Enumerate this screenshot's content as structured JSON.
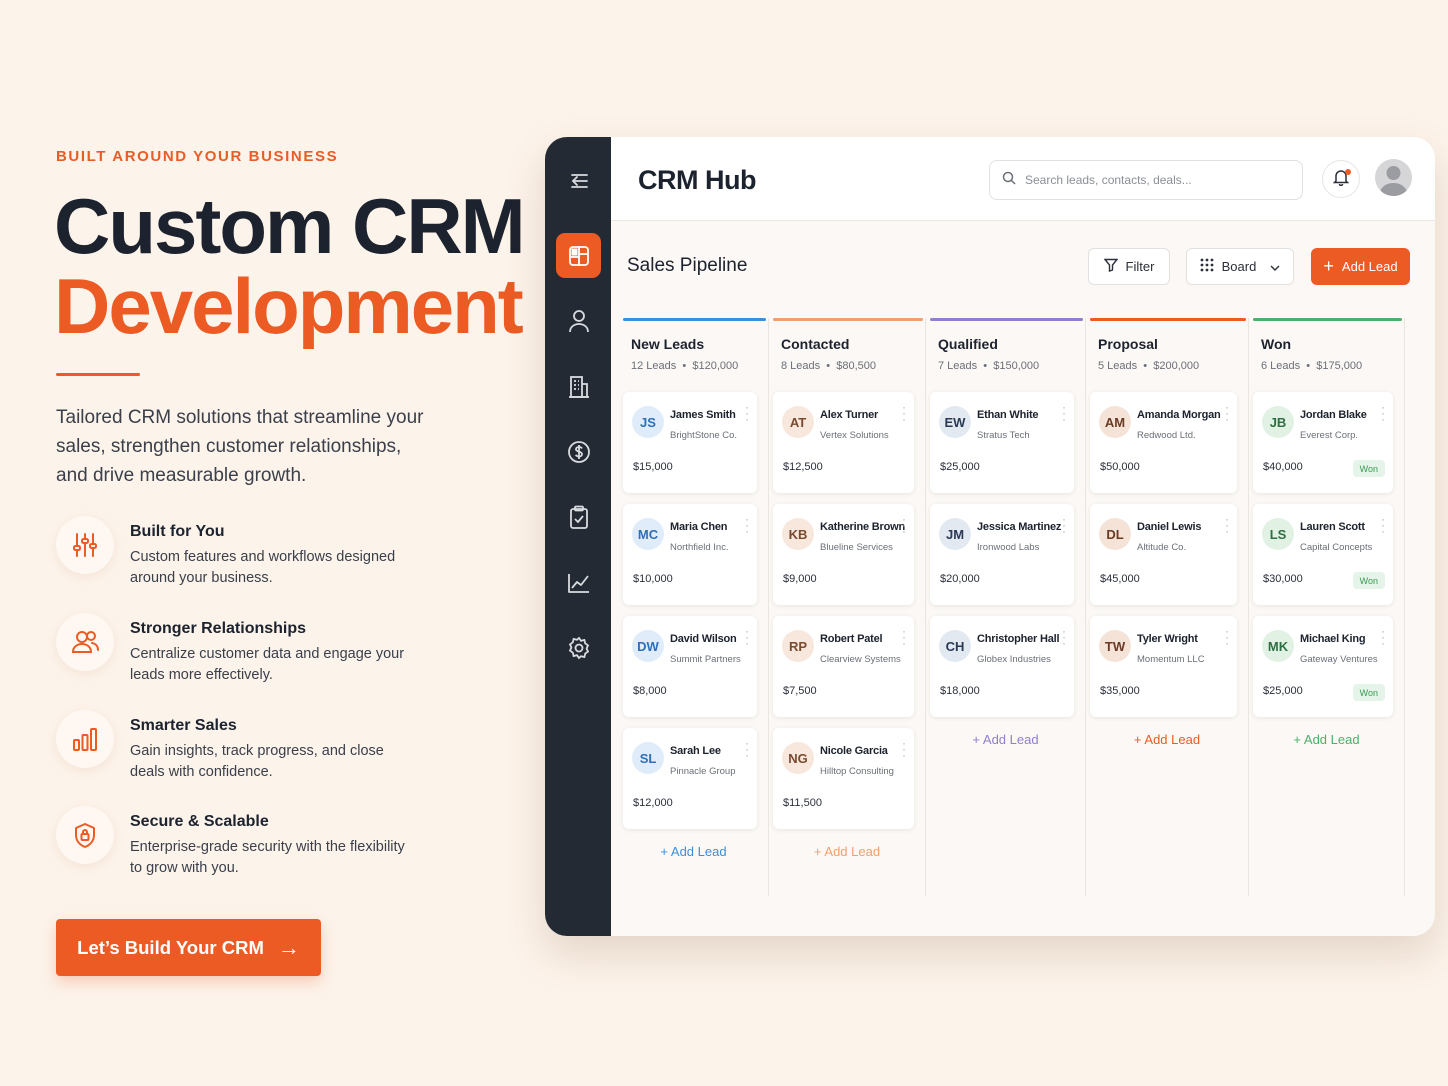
{
  "hero": {
    "eyebrow": "BUILT AROUND YOUR BUSINESS",
    "title_line1": "Custom CRM",
    "title_line2": "Development",
    "description": "Tailored CRM solutions that streamline your sales, strengthen customer relationships, and drive measurable growth.",
    "accent": "#ec5b24"
  },
  "features": [
    {
      "icon": "sliders-icon",
      "title": "Built for You",
      "desc": "Custom features and workflows designed around your business."
    },
    {
      "icon": "users-icon",
      "title": "Stronger Relationships",
      "desc": "Centralize customer data and engage your leads more effectively."
    },
    {
      "icon": "bar-chart-icon",
      "title": "Smarter Sales",
      "desc": "Gain insights, track progress, and close deals with confidence."
    },
    {
      "icon": "shield-lock-icon",
      "title": "Secure & Scalable",
      "desc": "Enterprise-grade security with the flexibility to grow with you."
    }
  ],
  "cta": {
    "label": "Let’s Build Your CRM",
    "arrow": "→"
  },
  "app": {
    "title": "CRM Hub",
    "search_placeholder": "Search leads, contacts, deals...",
    "sidebar": [
      "menu-icon",
      "dashboard-icon",
      "user-icon",
      "building-icon",
      "dollar-icon",
      "clipboard-check-icon",
      "chart-icon",
      "gear-icon"
    ],
    "page_title": "Sales Pipeline",
    "filter_label": "Filter",
    "board_label": "Board",
    "add_lead_label": "Add Lead",
    "columns": [
      {
        "name": "New Leads",
        "count": "12 Leads",
        "total": "$120,000",
        "color": "#3d8fd9",
        "add_label": "+ Add Lead",
        "cards": [
          {
            "initials": "JS",
            "name": "James Smith",
            "company": "BrightStone Co.",
            "amount": "$15,000"
          },
          {
            "initials": "MC",
            "name": "Maria Chen",
            "company": "Northfield Inc.",
            "amount": "$10,000"
          },
          {
            "initials": "DW",
            "name": "David Wilson",
            "company": "Summit Partners",
            "amount": "$8,000"
          },
          {
            "initials": "SL",
            "name": "Sarah Lee",
            "company": "Pinnacle Group",
            "amount": "$12,000"
          }
        ]
      },
      {
        "name": "Contacted",
        "count": "8 Leads",
        "total": "$80,500",
        "color": "#f0a070",
        "add_label": "+ Add Lead",
        "cards": [
          {
            "initials": "AT",
            "name": "Alex Turner",
            "company": "Vertex Solutions",
            "amount": "$12,500"
          },
          {
            "initials": "KB",
            "name": "Katherine Brown",
            "company": "Blueline Services",
            "amount": "$9,000"
          },
          {
            "initials": "RP",
            "name": "Robert Patel",
            "company": "Clearview Systems",
            "amount": "$7,500"
          },
          {
            "initials": "NG",
            "name": "Nicole Garcia",
            "company": "Hilltop Consulting",
            "amount": "$11,500"
          }
        ]
      },
      {
        "name": "Qualified",
        "count": "7 Leads",
        "total": "$150,000",
        "color": "#8f7fcf",
        "add_label": "+ Add Lead",
        "cards": [
          {
            "initials": "EW",
            "name": "Ethan White",
            "company": "Stratus Tech",
            "amount": "$25,000"
          },
          {
            "initials": "JM",
            "name": "Jessica Martinez",
            "company": "Ironwood Labs",
            "amount": "$20,000"
          },
          {
            "initials": "CH",
            "name": "Christopher Hall",
            "company": "Globex Industries",
            "amount": "$18,000"
          }
        ]
      },
      {
        "name": "Proposal",
        "count": "5 Leads",
        "total": "$200,000",
        "color": "#ec5b24",
        "add_label": "+ Add Lead",
        "cards": [
          {
            "initials": "AM",
            "name": "Amanda Morgan",
            "company": "Redwood Ltd.",
            "amount": "$50,000"
          },
          {
            "initials": "DL",
            "name": "Daniel Lewis",
            "company": "Altitude Co.",
            "amount": "$45,000"
          },
          {
            "initials": "TW",
            "name": "Tyler Wright",
            "company": "Momentum LLC",
            "amount": "$35,000"
          }
        ]
      },
      {
        "name": "Won",
        "count": "6 Leads",
        "total": "$175,000",
        "color": "#4fae6a",
        "add_label": "+ Add Lead",
        "cards": [
          {
            "initials": "JB",
            "name": "Jordan Blake",
            "company": "Everest Corp.",
            "amount": "$40,000",
            "badge": "Won"
          },
          {
            "initials": "LS",
            "name": "Lauren Scott",
            "company": "Capital Concepts",
            "amount": "$30,000",
            "badge": "Won"
          },
          {
            "initials": "MK",
            "name": "Michael King",
            "company": "Gateway Ventures",
            "amount": "$25,000",
            "badge": "Won"
          }
        ]
      }
    ]
  }
}
